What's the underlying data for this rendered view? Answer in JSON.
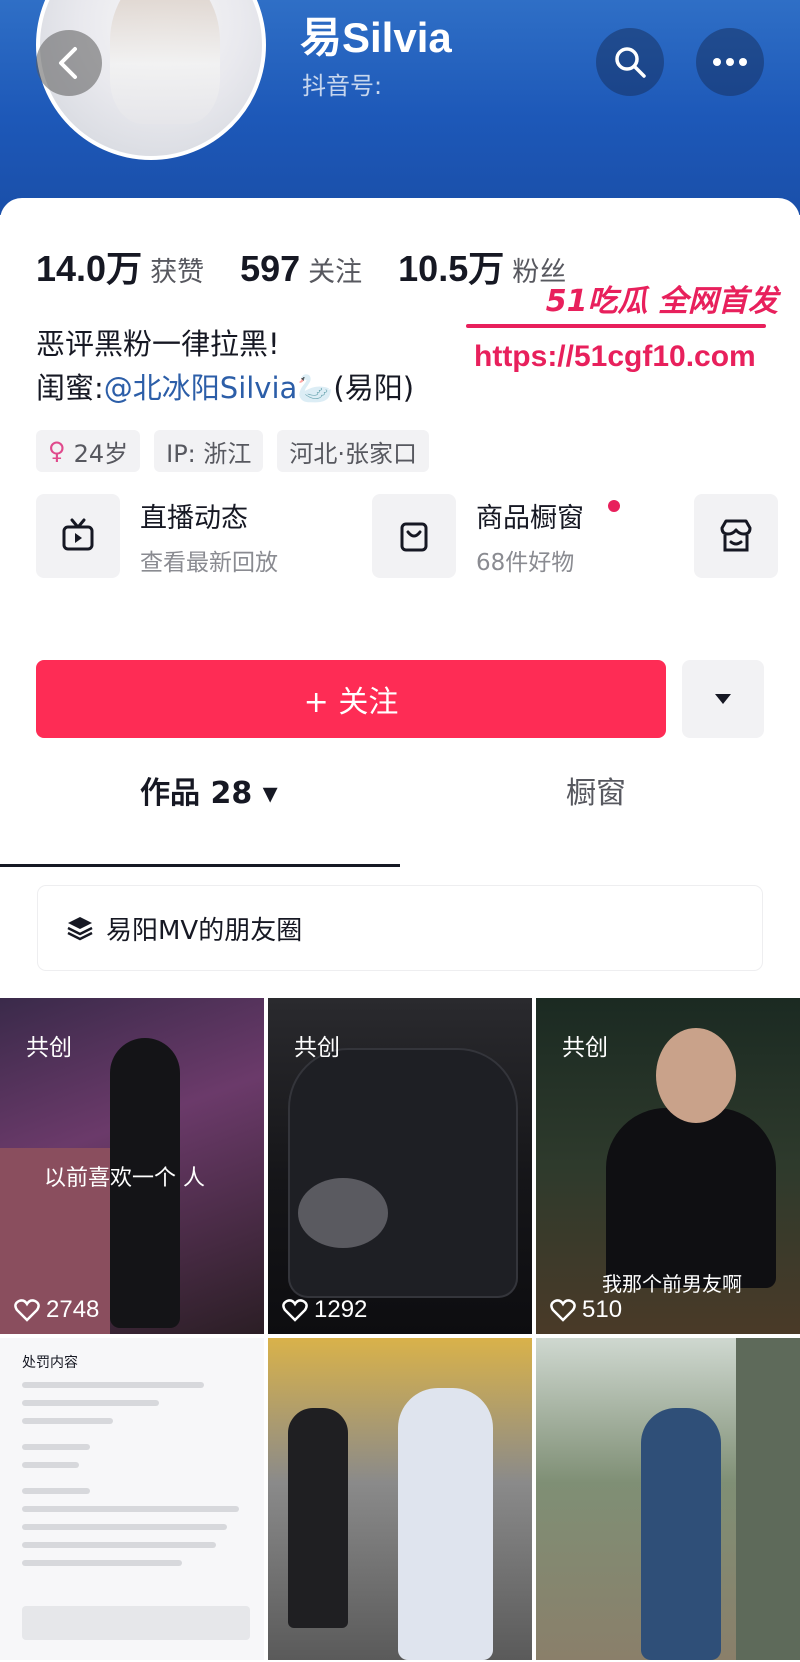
{
  "profile": {
    "nickname": "易Silvia",
    "douyin_id_label": "抖音号:"
  },
  "header": {
    "back_icon": "chevron-left-icon",
    "search_icon": "search-icon",
    "more_icon": "more-dots-icon"
  },
  "stats": [
    {
      "value": "14.0万",
      "label": "获赞"
    },
    {
      "value": "597",
      "label": "关注"
    },
    {
      "value": "10.5万",
      "label": "粉丝"
    }
  ],
  "watermark": {
    "brand": "51吃瓜 全网首发",
    "url": "https://51cgf10.com"
  },
  "bio": {
    "line1": "恶评黑粉一律拉黑!",
    "line2_prefix": "闺蜜:",
    "line2_mention": "@北冰阳Silvia🦢",
    "line2_suffix": "(易阳)"
  },
  "tags": [
    {
      "text": "24岁",
      "icon": "female-icon"
    },
    {
      "text": "IP: 浙江"
    },
    {
      "text": "河北·张家口"
    }
  ],
  "features": [
    {
      "title": "直播动态",
      "subtitle": "查看最新回放",
      "icon": "tv-icon"
    },
    {
      "title": "商品橱窗",
      "subtitle": "68件好物",
      "icon": "shopping-bag-icon"
    },
    {
      "title": "",
      "subtitle": "",
      "icon": "store-icon"
    }
  ],
  "actions": {
    "follow_label": "+ 关注",
    "dropdown_icon": "caret-down-icon"
  },
  "tabs": [
    {
      "label": "作品 28 ▾",
      "active": true
    },
    {
      "label": "橱窗",
      "active": false
    }
  ],
  "collection": {
    "label": "易阳MV的朋友圈",
    "icon": "layers-icon"
  },
  "videos": [
    {
      "badge": "共创",
      "likes": "2748",
      "caption": "以前喜欢一个 人"
    },
    {
      "badge": "共创",
      "likes": "1292",
      "caption": ""
    },
    {
      "badge": "共创",
      "likes": "510",
      "caption": "我那个前男友啊"
    },
    {
      "badge": "",
      "likes": "",
      "caption": "处罚内容"
    },
    {
      "badge": "",
      "likes": "",
      "caption": ""
    },
    {
      "badge": "",
      "likes": "",
      "caption": ""
    }
  ],
  "colors": {
    "header_blue": "#1d58b8",
    "follow_red": "#fe2c55",
    "watermark_pink": "#e8205c",
    "mention_blue": "#2c5ea8"
  }
}
